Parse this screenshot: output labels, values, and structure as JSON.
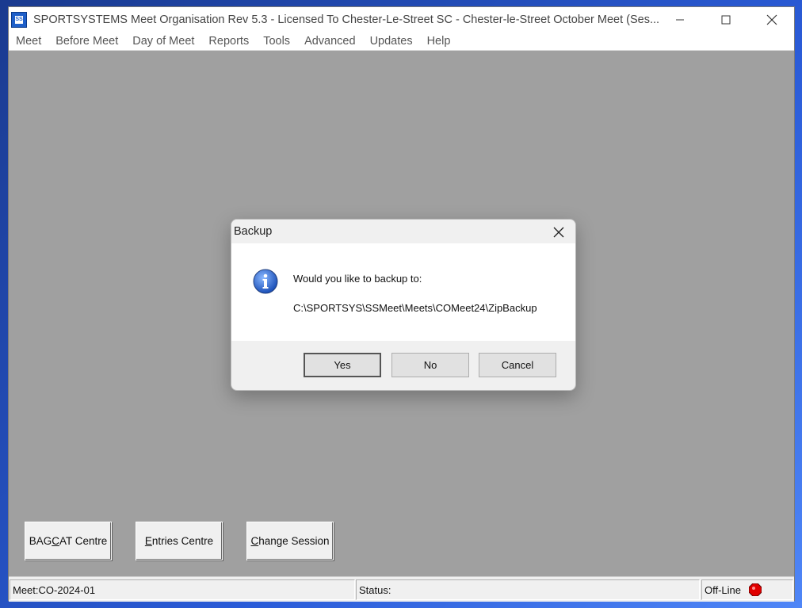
{
  "window": {
    "title": "SPORTSYSTEMS Meet Organisation Rev 5.3 - Licensed To Chester-Le-Street SC - Chester-le-Street October Meet  (Ses...",
    "icon_label": "SS"
  },
  "menu": {
    "items": [
      "Meet",
      "Before Meet",
      "Day of Meet",
      "Reports",
      "Tools",
      "Advanced",
      "Updates",
      "Help"
    ]
  },
  "dialog": {
    "title": "Backup",
    "message": "Would you like to backup to:",
    "path": "C:\\SPORTSYS\\SSMeet\\Meets\\COMeet24\\ZipBackup",
    "icon": "info-icon",
    "buttons": {
      "yes": "Yes",
      "no": "No",
      "cancel": "Cancel"
    }
  },
  "bottom_buttons": {
    "bagcat": {
      "pre": "BAG",
      "underline": "C",
      "post": "AT Centre"
    },
    "entries": {
      "pre": "",
      "underline": "E",
      "post": "ntries Centre"
    },
    "session": {
      "pre": "",
      "underline": "C",
      "post": "hange Session"
    }
  },
  "status_bar": {
    "meet": "Meet:CO-2024-01",
    "status": "Status:",
    "connection": "Off-Line",
    "connection_color": "#e00000"
  }
}
